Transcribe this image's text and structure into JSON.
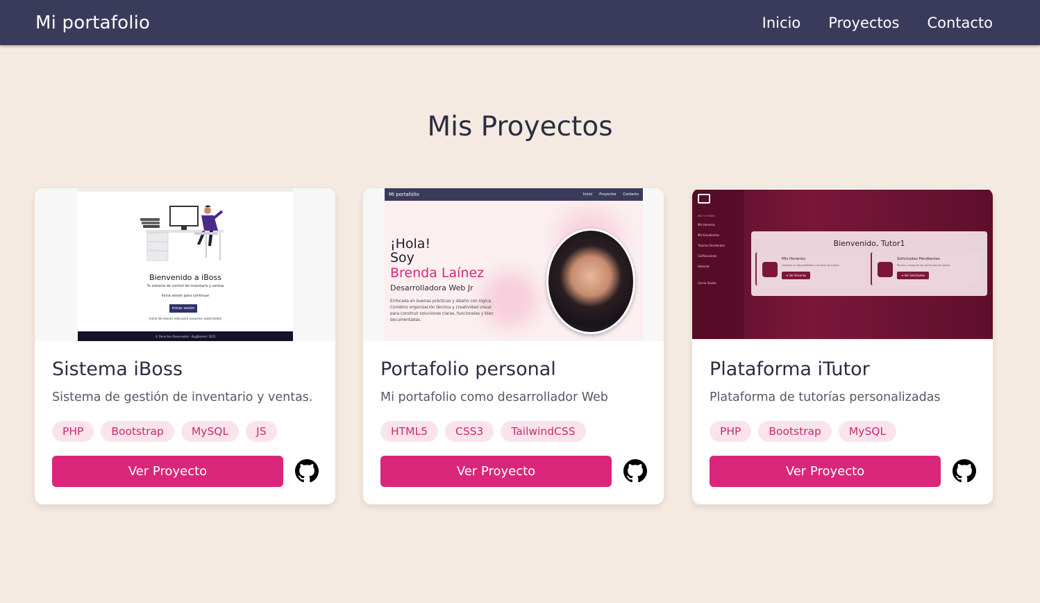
{
  "navbar": {
    "brand": "Mi portafolio",
    "links": [
      "Inicio",
      "Proyectos",
      "Contacto"
    ]
  },
  "main": {
    "title": "Mis Proyectos"
  },
  "colors": {
    "navbar_bg": "#3a3b5a",
    "page_bg": "#f5eae1",
    "accent": "#d9267a",
    "tag_bg": "#fbe3ec",
    "tag_text": "#c72a6e"
  },
  "projects": [
    {
      "title": "Sistema iBoss",
      "description": "Sistema de gestión de inventario y ventas.",
      "tags": [
        "PHP",
        "Bootstrap",
        "MySQL",
        "JS"
      ],
      "button": "Ver Proyecto",
      "icon": "github-icon",
      "thumbnail": {
        "heading": "Bienvenido a iBoss",
        "subtitle": "Tu sistema de control de inventario y ventas",
        "prompt": "Inicia sesion para continuar",
        "button": "Iniciar sesion",
        "note": "Inicio de sesion solo para usuarios autorizados",
        "footer": "© Derechos Reservados - BugBusters 2025"
      }
    },
    {
      "title": "Portafolio personal",
      "description": "Mi portafolio como desarrollador Web",
      "tags": [
        "HTML5",
        "CSS3",
        "TailwindCSS"
      ],
      "button": "Ver Proyecto",
      "icon": "github-icon",
      "thumbnail": {
        "brand": "Mi portafolio",
        "links": [
          "Inicio",
          "Proyectos",
          "Contacto"
        ],
        "greeting_1": "¡Hola!",
        "greeting_2": "Soy",
        "name": "Brenda Laínez",
        "role": "Desarrolladora Web Jr",
        "blurb": "Enfocada en buenas prácticas y diseño con lógica. Combino organización técnica y creatividad visual para construir soluciones claras, funcionales y bien documentadas."
      }
    },
    {
      "title": "Plataforma iTutor",
      "description": "Plataforma de tutorías personalizadas",
      "tags": [
        "PHP",
        "Bootstrap",
        "MySQL"
      ],
      "button": "Ver Proyecto",
      "icon": "github-icon",
      "thumbnail": {
        "sidebar_heading": "MIS TUTORÍAS",
        "sidebar": [
          "Mis Horarios",
          "Mis Estudiantes",
          "Tutorías Pendientes",
          "Calificaciones",
          "Historial",
          "Cerrar Sesión"
        ],
        "welcome": "Bienvenido, Tutor1",
        "cards": [
          {
            "title": "Mis Horarios",
            "text": "Gestiona tu disponibilidad y horarios de tutoría",
            "button": "➔ Ver Horarios"
          },
          {
            "title": "Solicitudes Pendientes",
            "text": "Revisa y responde las solicitudes de tutoría",
            "button": "➔ Ver Solicitudes"
          }
        ]
      }
    }
  ]
}
